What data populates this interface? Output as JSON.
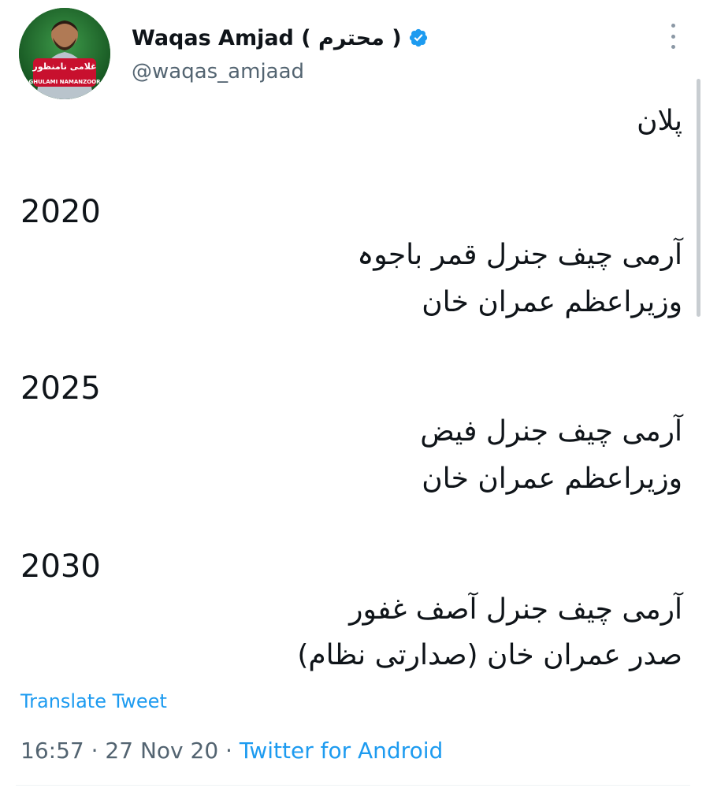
{
  "author": {
    "display_name": "Waqas Amjad ( محترم )",
    "handle": "@waqas_amjaad",
    "avatar_text": "غلامی نامنظور",
    "avatar_caption": "GHULAMI NAMANZOOR"
  },
  "tweet": {
    "title": "پلان",
    "sections": [
      {
        "year": "2020",
        "line1": "آرمی چیف جنرل قمر باجوہ",
        "line2": "وزیراعظم عمران خان"
      },
      {
        "year": "2025",
        "line1": "آرمی چیف جنرل فیض",
        "line2": "وزیراعظم عمران خان"
      },
      {
        "year": "2030",
        "line1": "آرمی چیف جنرل آصف غفور",
        "line2": "صدر عمران خان (صدارتی نظام)"
      }
    ],
    "translate_label": "Translate Tweet",
    "time": "16:57",
    "separator": "·",
    "date": "27 Nov 20",
    "source": "Twitter for Android"
  },
  "icons": {
    "verified": "verified-badge-icon",
    "more": "more-options-icon"
  },
  "colors": {
    "link": "#1d9bf0",
    "secondary_text": "#536471",
    "avatar_ring": "#ffffff",
    "avatar_banner": "#c8102e"
  }
}
